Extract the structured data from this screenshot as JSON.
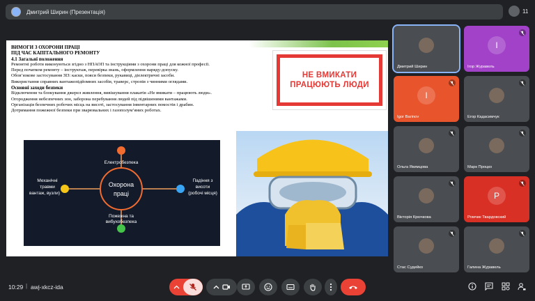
{
  "header": {
    "title": "Дмитрий Ширин (Презентація)",
    "participant_count": "11"
  },
  "slide": {
    "lines": [
      {
        "text": "ВИМОГИ З ОХОРОНИ ПРАЦІ",
        "bold": true
      },
      {
        "text": "ПІД ЧАС КАПІТАЛЬНОГО РЕМОНТУ",
        "bold": true
      },
      {
        "text": "4.1 Загальні положення",
        "bold": true
      },
      {
        "text": "Ремонтні роботи виконуються згідно з НПАОП та інструкціями з охорони праці для кожної професії.",
        "bold": false
      },
      {
        "text": "Перед початком ремонту – інструктаж, перевірка знань, оформлення наряду-допуску.",
        "bold": false
      },
      {
        "text": "Обов’язкове застосування ЗІЗ: каски, пояси безпеки, рукавиці, діелектричні засоби.",
        "bold": false
      },
      {
        "text": "Використання справних вантажопідйомних засобів, траверс, стропів з чинними оглядами.",
        "bold": false
      },
      {
        "text": "Основні заходи безпеки",
        "bold": true
      },
      {
        "text": "Відключення та блокування джерел живлення, вивішування плакатів «Не вмикати – працюють люди».",
        "bold": false
      },
      {
        "text": "Огородження небезпечних зон, заборона перебування людей під підвішеними вантажами.",
        "bold": false
      },
      {
        "text": "Організація безпечних робочих місць на висоті, застосування інвентарних помостів і драбин.",
        "bold": false
      },
      {
        "text": "Дотримання пожежної безпеки при зварювальних і газополум’яних роботах.",
        "bold": false
      }
    ],
    "sign_line1": "НЕ ВМИКАТИ",
    "sign_line2": "ПРАЦЮЮТЬ ЛЮДИ",
    "diagram": {
      "center_line1": "Охорона",
      "center_line2": "праці",
      "top": "Електробезпека",
      "left_line1": "Механічні",
      "left_line2": "травми",
      "left_line3": "вантаж, вузли)",
      "right_line1": "Падіння з",
      "right_line2": "висоти",
      "right_line3": "(робочі місця)",
      "bottom_line1": "Пожежна та",
      "bottom_line2": "вибухобезпека",
      "colors": {
        "top": "#f26b2f",
        "left": "#f5c518",
        "right": "#3aa5f2",
        "bottom": "#45c34a"
      }
    }
  },
  "participants": [
    {
      "name": "Дмитрий Ширин",
      "type": "video",
      "muted": false,
      "active": true
    },
    {
      "name": "Ігор Журавель",
      "type": "initial",
      "initial": "І",
      "color": "#a142c8",
      "muted": true
    },
    {
      "name": "Igor Barinov",
      "type": "initial",
      "initial": "I",
      "color": "#e8542b",
      "muted": true
    },
    {
      "name": "Егор Кадасимчук",
      "type": "video",
      "muted": true
    },
    {
      "name": "Ольга Якимцова",
      "type": "video",
      "muted": true
    },
    {
      "name": "Марк Процко",
      "type": "video",
      "muted": true
    },
    {
      "name": "Вікторія Крючкова",
      "type": "video",
      "muted": true
    },
    {
      "name": "Ромчик Твардовский",
      "type": "initial",
      "initial": "Р",
      "color": "#d93025",
      "muted": true
    },
    {
      "name": "Стас Судейко",
      "type": "video",
      "muted": true
    },
    {
      "name": "Галина Журавель",
      "type": "video",
      "muted": true
    }
  ],
  "footer": {
    "time": "10:29",
    "separator": "|",
    "meeting_code": "awj-xkcz-ida"
  }
}
